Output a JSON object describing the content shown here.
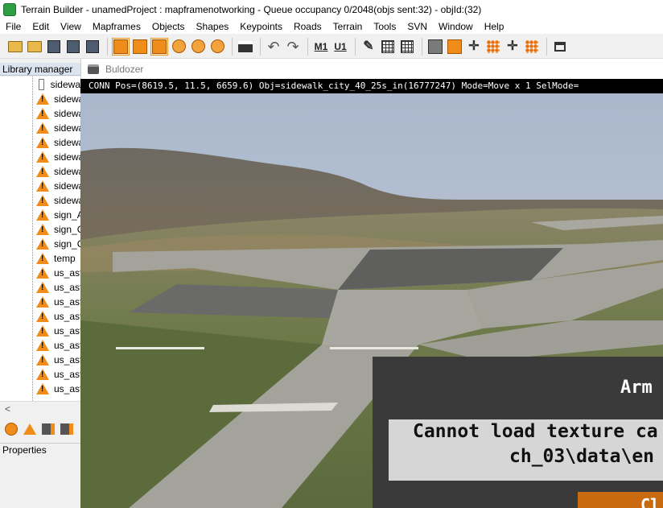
{
  "window": {
    "title": "Terrain Builder - unamedProject : mapframenotworking - Queue occupancy 0/2048(objs sent:32) - objId:(32)"
  },
  "menu": [
    "File",
    "Edit",
    "View",
    "Mapframes",
    "Objects",
    "Shapes",
    "Keypoints",
    "Roads",
    "Terrain",
    "Tools",
    "SVN",
    "Window",
    "Help"
  ],
  "toolbar": {
    "m1_label": "M",
    "m1_sub": "1",
    "u1_label": "U",
    "u1_sub": "1"
  },
  "library": {
    "header": "Library manager",
    "items": [
      {
        "label": "sidewa",
        "icon": "document-icon"
      },
      {
        "label": "sidewa",
        "icon": "warning-icon"
      },
      {
        "label": "sidewa",
        "icon": "warning-icon"
      },
      {
        "label": "sidewa",
        "icon": "warning-icon"
      },
      {
        "label": "sidewa",
        "icon": "warning-icon"
      },
      {
        "label": "sidewa",
        "icon": "warning-icon"
      },
      {
        "label": "sidewa",
        "icon": "warning-icon"
      },
      {
        "label": "sidewa",
        "icon": "warning-icon"
      },
      {
        "label": "sidewa",
        "icon": "warning-icon"
      },
      {
        "label": "sign_A",
        "icon": "warning-icon"
      },
      {
        "label": "sign_C",
        "icon": "warning-icon"
      },
      {
        "label": "sign_C",
        "icon": "warning-icon"
      },
      {
        "label": "temp",
        "icon": "warning-icon"
      },
      {
        "label": "us_asf",
        "icon": "warning-icon"
      },
      {
        "label": "us_asf",
        "icon": "warning-icon"
      },
      {
        "label": "us_asf",
        "icon": "warning-icon"
      },
      {
        "label": "us_asf",
        "icon": "warning-icon"
      },
      {
        "label": "us_asf",
        "icon": "warning-icon"
      },
      {
        "label": "us_asf",
        "icon": "warning-icon"
      },
      {
        "label": "us_asf",
        "icon": "warning-icon"
      },
      {
        "label": "us_asf",
        "icon": "warning-icon"
      },
      {
        "label": "us_asf",
        "icon": "warning-icon"
      }
    ],
    "scroll_left": "<"
  },
  "properties": {
    "header": "Properties"
  },
  "buldozer": {
    "title": "Buldozer",
    "status": "CONN Pos=(8619.5, 11.5, 6659.6) Obj=sidewalk_city_40_25s_in(16777247) Mode=Move x 1 SelMode=",
    "error_title": "Arm",
    "error_line1": "Cannot load texture ca",
    "error_line2": "ch_03\\data\\en",
    "error_button": "Cl"
  },
  "colors": {
    "accent_orange": "#f08c1a",
    "dialog_bg": "#3a3a3a",
    "dialog_box": "#d6d6d6",
    "status_bg": "#000000"
  }
}
